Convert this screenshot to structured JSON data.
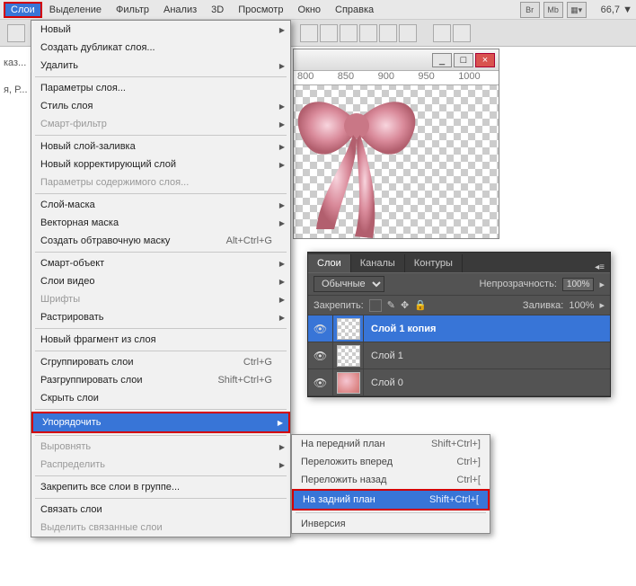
{
  "menubar": {
    "items": [
      "Слои",
      "Выделение",
      "Фильтр",
      "Анализ",
      "3D",
      "Просмотр",
      "Окно",
      "Справка"
    ],
    "tool_btn1": "Br",
    "tool_btn2": "Mb",
    "zoom": "66,7",
    "zoom_arrow": "▼"
  },
  "left_tags": {
    "a": "каз...",
    "b": "я, Р..."
  },
  "dropdown": {
    "items": [
      {
        "label": "Новый",
        "sub": true
      },
      {
        "label": "Создать дубликат слоя..."
      },
      {
        "label": "Удалить",
        "sub": true
      },
      {
        "kind": "sep"
      },
      {
        "label": "Параметры слоя..."
      },
      {
        "label": "Стиль слоя",
        "sub": true
      },
      {
        "label": "Смарт-фильтр",
        "sub": true,
        "disabled": true
      },
      {
        "kind": "sep"
      },
      {
        "label": "Новый слой-заливка",
        "sub": true
      },
      {
        "label": "Новый корректирующий слой",
        "sub": true
      },
      {
        "label": "Параметры содержимого слоя...",
        "disabled": true
      },
      {
        "kind": "sep"
      },
      {
        "label": "Слой-маска",
        "sub": true
      },
      {
        "label": "Векторная маска",
        "sub": true
      },
      {
        "label": "Создать обтравочную маску",
        "shortcut": "Alt+Ctrl+G"
      },
      {
        "kind": "sep"
      },
      {
        "label": "Смарт-объект",
        "sub": true
      },
      {
        "label": "Слои видео",
        "sub": true
      },
      {
        "label": "Шрифты",
        "sub": true,
        "disabled": true
      },
      {
        "label": "Растрировать",
        "sub": true
      },
      {
        "kind": "sep"
      },
      {
        "label": "Новый фрагмент из слоя"
      },
      {
        "kind": "sep"
      },
      {
        "label": "Сгруппировать слои",
        "shortcut": "Ctrl+G"
      },
      {
        "label": "Разгруппировать слои",
        "shortcut": "Shift+Ctrl+G"
      },
      {
        "label": "Скрыть слои"
      },
      {
        "kind": "sep"
      },
      {
        "label": "Упорядочить",
        "sub": true,
        "highlight": true,
        "red": true
      },
      {
        "kind": "sep"
      },
      {
        "label": "Выровнять",
        "sub": true,
        "disabled": true
      },
      {
        "label": "Распределить",
        "sub": true,
        "disabled": true
      },
      {
        "kind": "sep"
      },
      {
        "label": "Закрепить все слои в группе..."
      },
      {
        "kind": "sep"
      },
      {
        "label": "Связать слои"
      },
      {
        "label": "Выделить связанные слои",
        "disabled": true
      }
    ]
  },
  "submenu": {
    "items": [
      {
        "label": "На передний план",
        "shortcut": "Shift+Ctrl+]"
      },
      {
        "label": "Переложить вперед",
        "shortcut": "Ctrl+]"
      },
      {
        "label": "Переложить назад",
        "shortcut": "Ctrl+["
      },
      {
        "label": "На задний план",
        "shortcut": "Shift+Ctrl+[",
        "highlight": true,
        "red": true
      },
      {
        "label": "Инверсия"
      }
    ]
  },
  "ruler": [
    "800",
    "850",
    "900",
    "950",
    "1000"
  ],
  "panel": {
    "tabs": [
      "Слои",
      "Каналы",
      "Контуры"
    ],
    "blend_mode": "Обычные",
    "opacity_lbl": "Непрозрачность:",
    "opacity": "100%",
    "lock_lbl": "Закрепить:",
    "fill_lbl": "Заливка:",
    "fill": "100%",
    "layers": [
      {
        "name": "Слой 1 копия",
        "active": true
      },
      {
        "name": "Слой 1"
      },
      {
        "name": "Слой 0",
        "pink": true
      }
    ]
  },
  "doc_btns": {
    "min": "_",
    "max": "□",
    "close": "×"
  }
}
